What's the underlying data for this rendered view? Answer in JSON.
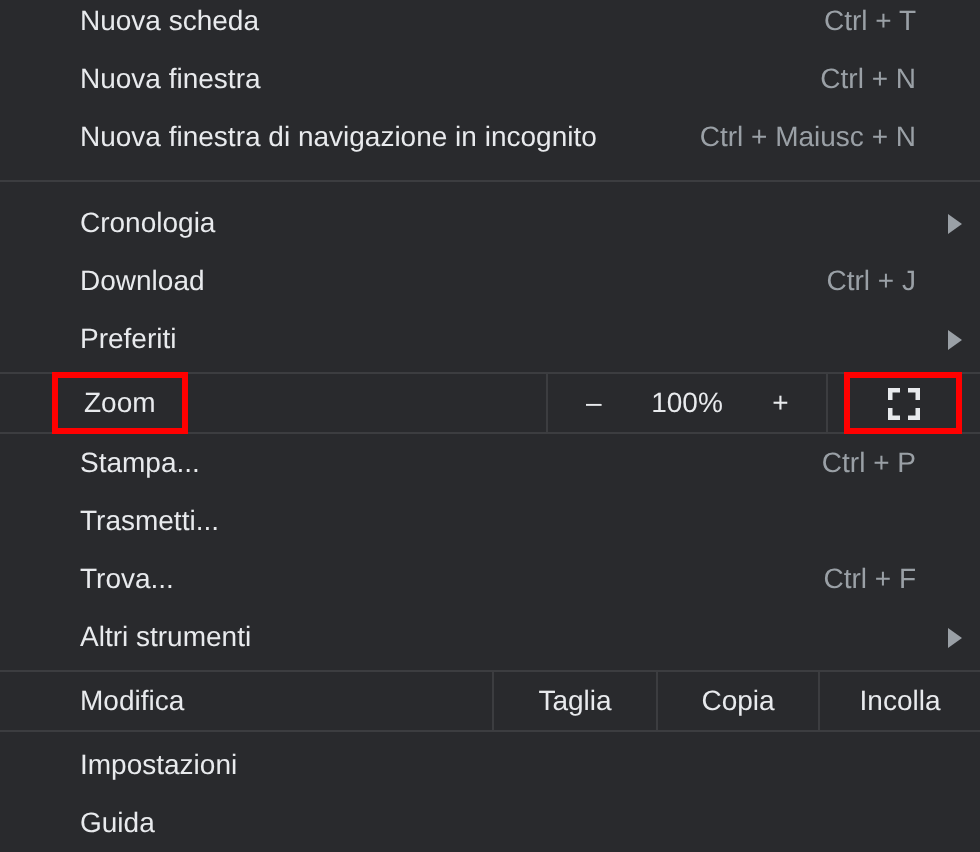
{
  "menu": [
    {
      "kind": "item",
      "label": "Nuova scheda",
      "shortcut": "Ctrl + T",
      "submenu": false
    },
    {
      "kind": "item",
      "label": "Nuova finestra",
      "shortcut": "Ctrl + N",
      "submenu": false
    },
    {
      "kind": "item",
      "label": "Nuova finestra di navigazione in incognito",
      "shortcut": "Ctrl + Maiusc + N",
      "submenu": false
    },
    {
      "kind": "separator"
    },
    {
      "kind": "item",
      "label": "Cronologia",
      "submenu": true
    },
    {
      "kind": "item",
      "label": "Download",
      "shortcut": "Ctrl + J",
      "submenu": false
    },
    {
      "kind": "item",
      "label": "Preferiti",
      "submenu": true
    },
    {
      "kind": "zoom",
      "label": "Zoom",
      "highlighted": true,
      "minus": "–",
      "value": "100%",
      "plus": "+",
      "fullscreen_highlighted": true
    },
    {
      "kind": "item",
      "label": "Stampa...",
      "shortcut": "Ctrl + P",
      "submenu": false
    },
    {
      "kind": "item",
      "label": "Trasmetti...",
      "submenu": false
    },
    {
      "kind": "item",
      "label": "Trova...",
      "shortcut": "Ctrl + F",
      "submenu": false
    },
    {
      "kind": "item",
      "label": "Altri strumenti",
      "submenu": true
    },
    {
      "kind": "edit",
      "label": "Modifica",
      "actions": [
        "Taglia",
        "Copia",
        "Incolla"
      ]
    },
    {
      "kind": "item",
      "label": "Impostazioni",
      "submenu": false
    },
    {
      "kind": "item",
      "label": "Guida",
      "submenu": false
    }
  ]
}
